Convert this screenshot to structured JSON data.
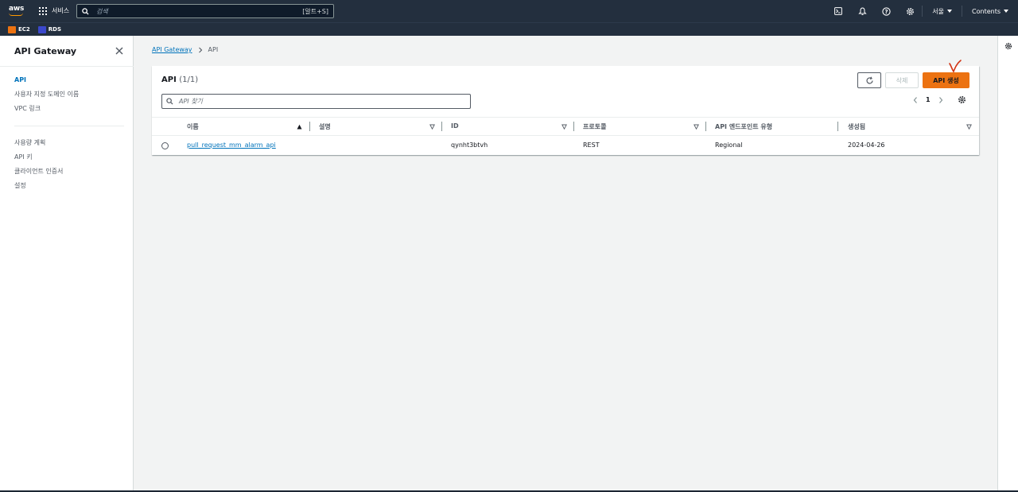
{
  "topnav": {
    "logo": "aws",
    "services_label": "서비스",
    "search_placeholder": "검색",
    "search_shortcut": "[알트+S]",
    "region": "서울",
    "account": "Contents",
    "icons": [
      "cloudshell-icon",
      "bell-icon",
      "help-icon",
      "settings-icon"
    ]
  },
  "favorites": [
    {
      "label": "EC2",
      "color": "#ec7211"
    },
    {
      "label": "RDS",
      "color": "#3b48cc"
    }
  ],
  "sidebar": {
    "title": "API Gateway",
    "items": [
      {
        "label": "API",
        "active": true
      },
      {
        "label": "사용자 지정 도메인 이름",
        "active": false
      },
      {
        "label": "VPC 링크",
        "active": false
      },
      {
        "label": "사용량 계획",
        "active": false
      },
      {
        "label": "API 키",
        "active": false
      },
      {
        "label": "클라이언트 인증서",
        "active": false
      },
      {
        "label": "설정",
        "active": false
      }
    ]
  },
  "breadcrumb": {
    "root": "API Gateway",
    "current": "API"
  },
  "table": {
    "title": "API",
    "count": "(1/1)",
    "delete_label": "삭제",
    "create_label": "API 생성",
    "filter_placeholder": "API 찾기",
    "page": "1",
    "columns": [
      "이름",
      "설명",
      "ID",
      "프로토콜",
      "API 엔드포인트 유형",
      "생성됨"
    ],
    "rows": [
      {
        "name": "pull_request_mm_alarm_api",
        "description": "",
        "id": "qynht3btvh",
        "protocol": "REST",
        "endpoint_type": "Regional",
        "created": "2024-04-26"
      }
    ]
  },
  "colors": {
    "nav_bg": "#232f3e",
    "primary": "#ec7211",
    "link": "#0073bb",
    "annotation": "#d13212"
  }
}
